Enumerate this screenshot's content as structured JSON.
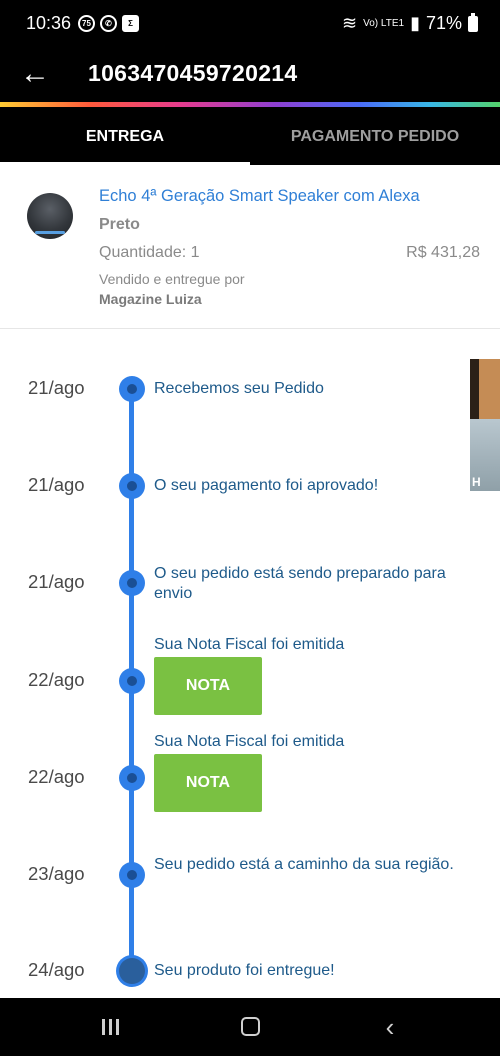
{
  "status_bar": {
    "time": "10:36",
    "notif_badge": "75",
    "network": "Vo) LTE1",
    "battery": "71%"
  },
  "app_bar": {
    "title": "1063470459720214",
    "back_icon": "arrow-left"
  },
  "tabs": [
    {
      "label": "ENTREGA",
      "active": true
    },
    {
      "label": "PAGAMENTO PEDIDO",
      "active": false
    }
  ],
  "product": {
    "name": "Echo 4ª Geração Smart Speaker com Alexa",
    "color": "Preto",
    "quantity": "Quantidade: 1",
    "price": "R$ 431,28",
    "sold_by_label": "Vendido e entregue por",
    "seller": "Magazine Luiza"
  },
  "timeline": [
    {
      "date": "21/ago",
      "text": "Recebemos seu Pedido"
    },
    {
      "date": "21/ago",
      "text": "O seu pagamento foi aprovado!"
    },
    {
      "date": "21/ago",
      "text": "O seu pedido está sendo preparado para envio"
    },
    {
      "date": "22/ago",
      "text": "Sua Nota Fiscal foi emitida",
      "button": "NOTA"
    },
    {
      "date": "22/ago",
      "text": "Sua Nota Fiscal foi emitida",
      "button": "NOTA"
    },
    {
      "date": "23/ago",
      "text": "Seu pedido está a caminho da sua região."
    },
    {
      "date": "24/ago",
      "text": "Seu produto foi entregue!"
    }
  ],
  "overlay_thumbnail": {
    "label": "H"
  },
  "colors": {
    "accent_blue": "#2f7fe8",
    "link_blue": "#2f7fd6",
    "nota_green": "#7ac142",
    "dark": "#000000"
  }
}
